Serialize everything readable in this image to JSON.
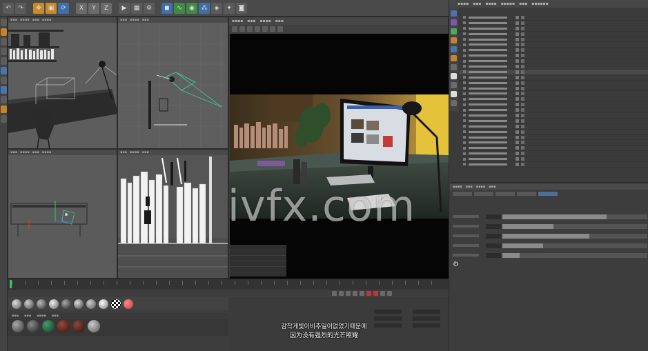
{
  "subtitles": {
    "line1": "감착게빛이비추일이없었기때문에",
    "line2": "因为没有强烈的光芒照耀"
  },
  "watermark": "ivfx.com",
  "colors": {
    "accent_green": "#3cc36b",
    "accent_orange": "#c98a2a",
    "accent_blue": "#3f6ea8",
    "record_red": "#b83a3a"
  },
  "icons": {
    "toolbar": [
      "undo-icon",
      "redo-icon",
      "move-icon",
      "scale-icon",
      "rotate-icon",
      "x-axis-icon",
      "y-axis-icon",
      "z-axis-icon",
      "render-icon",
      "render-view-icon",
      "render-settings-icon",
      "cube-icon",
      "spline-icon",
      "nurbs-icon",
      "array-icon",
      "deformer-icon",
      "light-icon",
      "camera-icon"
    ],
    "materials": [
      "material-ball-1",
      "material-ball-2",
      "material-ball-3",
      "material-ball-4",
      "material-ball-5",
      "material-ball-6",
      "material-ball-7",
      "material-ball-8",
      "material-ball-9",
      "material-ball-10"
    ]
  }
}
